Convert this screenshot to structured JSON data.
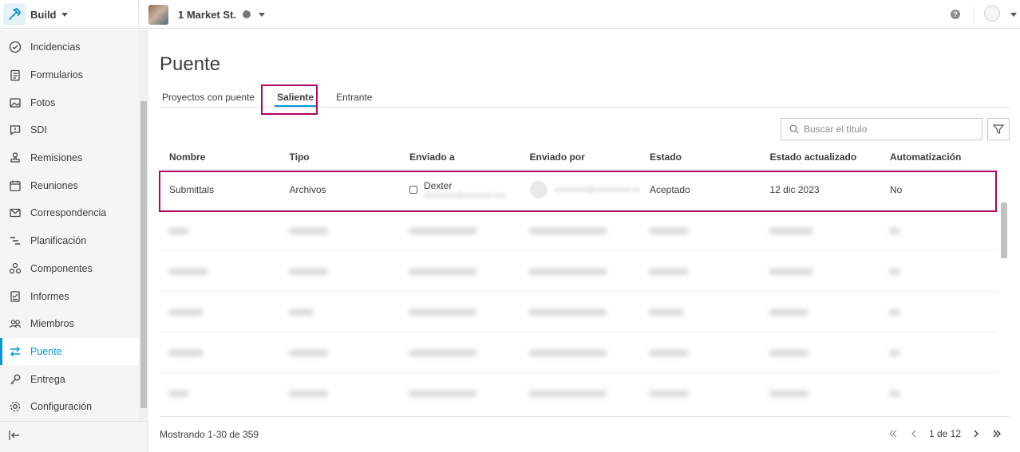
{
  "app": {
    "name": "Build"
  },
  "project": {
    "name": "1 Market St."
  },
  "help": {
    "label": "?"
  },
  "sidebar": {
    "items": [
      {
        "label": "Incidencias",
        "icon": "check-circle-icon"
      },
      {
        "label": "Formularios",
        "icon": "clipboard-icon"
      },
      {
        "label": "Fotos",
        "icon": "image-icon"
      },
      {
        "label": "SDI",
        "icon": "chat-icon"
      },
      {
        "label": "Remisiones",
        "icon": "stamp-icon"
      },
      {
        "label": "Reuniones",
        "icon": "calendar-people-icon"
      },
      {
        "label": "Correspondencia",
        "icon": "envelope-icon"
      },
      {
        "label": "Planificación",
        "icon": "gantt-icon"
      },
      {
        "label": "Componentes",
        "icon": "components-icon"
      },
      {
        "label": "Informes",
        "icon": "report-icon"
      },
      {
        "label": "Miembros",
        "icon": "members-icon"
      },
      {
        "label": "Puente",
        "icon": "bridge-icon"
      },
      {
        "label": "Entrega",
        "icon": "key-icon"
      },
      {
        "label": "Configuración",
        "icon": "gear-icon"
      }
    ],
    "active": "Puente"
  },
  "page": {
    "title": "Puente"
  },
  "tabs": [
    {
      "label": "Proyectos con puente"
    },
    {
      "label": "Saliente"
    },
    {
      "label": "Entrante"
    }
  ],
  "search": {
    "placeholder": "Buscar el título"
  },
  "table": {
    "headers": [
      "Nombre",
      "Tipo",
      "Enviado a",
      "Enviado por",
      "Estado",
      "Estado actualizado",
      "Automatización"
    ],
    "rows": [
      {
        "name": "Submittals",
        "type": "Archivos",
        "sent_to": "Dexter",
        "status": "Aceptado",
        "updated": "12 dic 2023",
        "automation": "No"
      }
    ]
  },
  "footer": {
    "showing": "Mostrando 1-30 de 359",
    "page": "1 de 12"
  },
  "colors": {
    "accent": "#0696d7",
    "highlight": "#b3006b"
  }
}
